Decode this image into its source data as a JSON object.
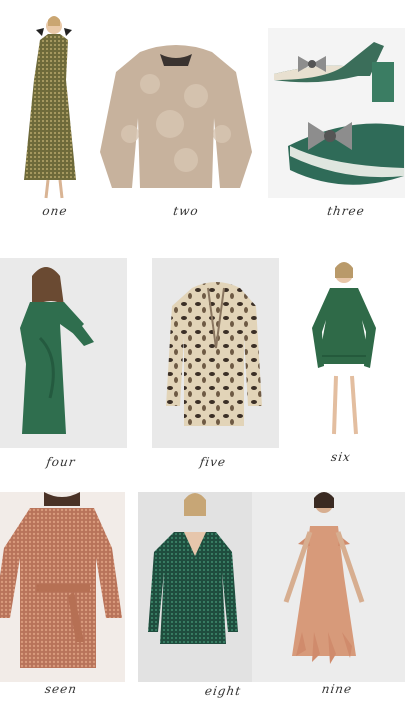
{
  "items": [
    {
      "caption": "one",
      "product": "sequin-maxi-dress-icon"
    },
    {
      "caption": "two",
      "product": "faux-fur-jacket-icon"
    },
    {
      "caption": "three",
      "product": "embellished-bow-heels-icon"
    },
    {
      "caption": "four",
      "product": "green-velvet-wrap-dress-icon"
    },
    {
      "caption": "five",
      "product": "leopard-fur-coat-icon"
    },
    {
      "caption": "six",
      "product": "green-tiered-mini-dress-icon"
    },
    {
      "caption": "seen",
      "product": "rose-gold-sequin-dress-icon"
    },
    {
      "caption": "eight",
      "product": "emerald-sequin-wrap-dress-icon"
    },
    {
      "caption": "nine",
      "product": "feather-hem-slip-dress-icon"
    }
  ]
}
